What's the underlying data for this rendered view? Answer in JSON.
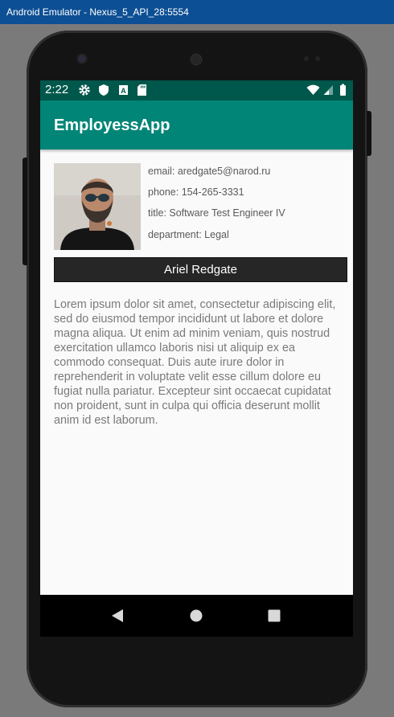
{
  "window": {
    "title": "Android Emulator - Nexus_5_API_28:5554"
  },
  "status_bar": {
    "time": "2:22"
  },
  "app_bar": {
    "title": "EmployessApp"
  },
  "employee": {
    "email": "email: aredgate5@narod.ru",
    "phone": "phone: 154-265-3331",
    "title": "title: Software Test Engineer IV",
    "department": "department: Legal",
    "name": "Ariel Redgate"
  },
  "description": "Lorem ipsum dolor sit amet, consectetur adipiscing elit, sed do eiusmod tempor incididunt ut labore et dolore magna aliqua. Ut enim ad minim veniam, quis nostrud exercitation ullamco laboris nisi ut aliquip ex ea commodo consequat. Duis aute irure dolor in reprehenderit in voluptate velit esse cillum dolore eu fugiat nulla pariatur. Excepteur sint occaecat cupidatat non proident, sunt in culpa qui officia deserunt mollit anim id est laborum.",
  "icons": {
    "status_left": [
      "gear-icon",
      "shield-icon",
      "a-box-icon",
      "sd-card-icon"
    ],
    "status_right": [
      "wifi-icon",
      "signal-icon",
      "battery-icon"
    ],
    "nav": [
      "back-icon",
      "home-icon",
      "recents-icon"
    ]
  },
  "colors": {
    "status_bar": "#00574b",
    "app_bar": "#008577",
    "name_bar": "#262626",
    "window_titlebar": "#0d4f94"
  }
}
